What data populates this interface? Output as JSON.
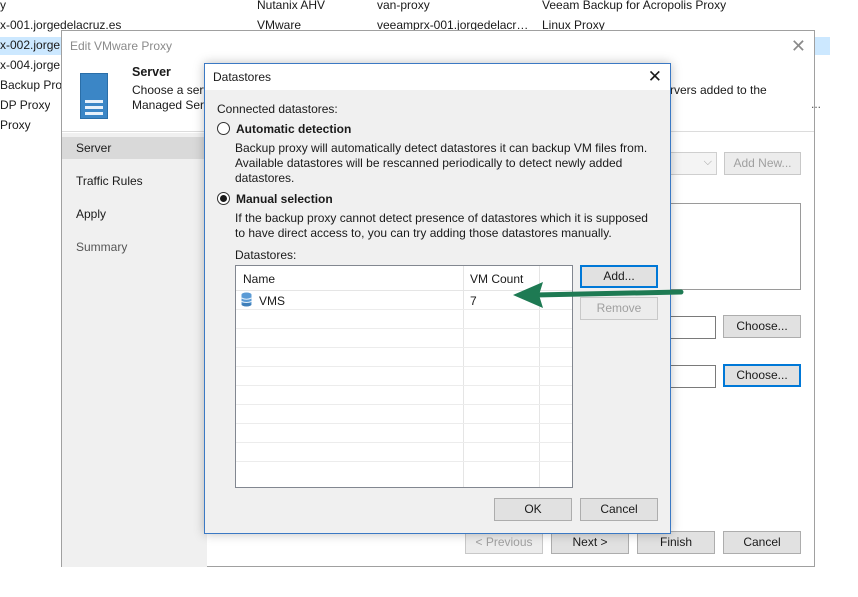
{
  "background_list": {
    "rows": [
      [
        "y",
        "Nutanix AHV",
        "van-proxy",
        "Veeam Backup for Acropolis Proxy"
      ],
      [
        "x-001.jorgedelacruz.es",
        "VMware",
        "veeamprx-001.jorgedelacr…",
        "Linux Proxy"
      ],
      [
        "x-002.jorge",
        "",
        "",
        ""
      ],
      [
        "x-004.jorge",
        "",
        "",
        ""
      ],
      [
        "Backup Prox",
        "",
        "",
        ""
      ],
      [
        "DP Proxy",
        "",
        "",
        ""
      ],
      [
        "Proxy",
        "",
        "",
        ""
      ]
    ]
  },
  "wizard": {
    "title": "Edit VMware Proxy",
    "step_title": "Server",
    "desc_line1": "Choose a server",
    "desc_line2": "Managed Server",
    "desc_right": "rvers added to the",
    "dots": "...",
    "nav": [
      "Server",
      "Traffic Rules",
      "Apply",
      "Summary"
    ],
    "add_new_label": "Add New...",
    "choose1_label": "Choose...",
    "choose2_label": "Choose...",
    "previous_label": "< Previous",
    "next_label": "Next >",
    "finish_label": "Finish",
    "cancel_label": "Cancel"
  },
  "dialog": {
    "title": "Datastores",
    "connected_label": "Connected datastores:",
    "auto": {
      "label": "Automatic detection",
      "desc_lines": [
        "Backup proxy will automatically detect datastores it can backup VM files from.",
        "Available datastores will be rescanned periodically to detect newly added",
        "datastores."
      ],
      "selected": false
    },
    "manual": {
      "label": "Manual selection",
      "desc_lines": [
        "If the backup proxy cannot detect presence of datastores which it is supposed",
        "to have direct access to, you can try adding those datastores manually."
      ],
      "selected": true
    },
    "datastores_label": "Datastores:",
    "columns": [
      "Name",
      "VM Count"
    ],
    "rows": [
      {
        "name": "VMS",
        "vm_count": "7",
        "icon": "database-icon"
      }
    ],
    "add_label": "Add...",
    "remove_label": "Remove",
    "ok_label": "OK",
    "cancel_label": "Cancel"
  },
  "annotation": {
    "icon": "arrow-left-icon",
    "color": "#1e7a53"
  }
}
